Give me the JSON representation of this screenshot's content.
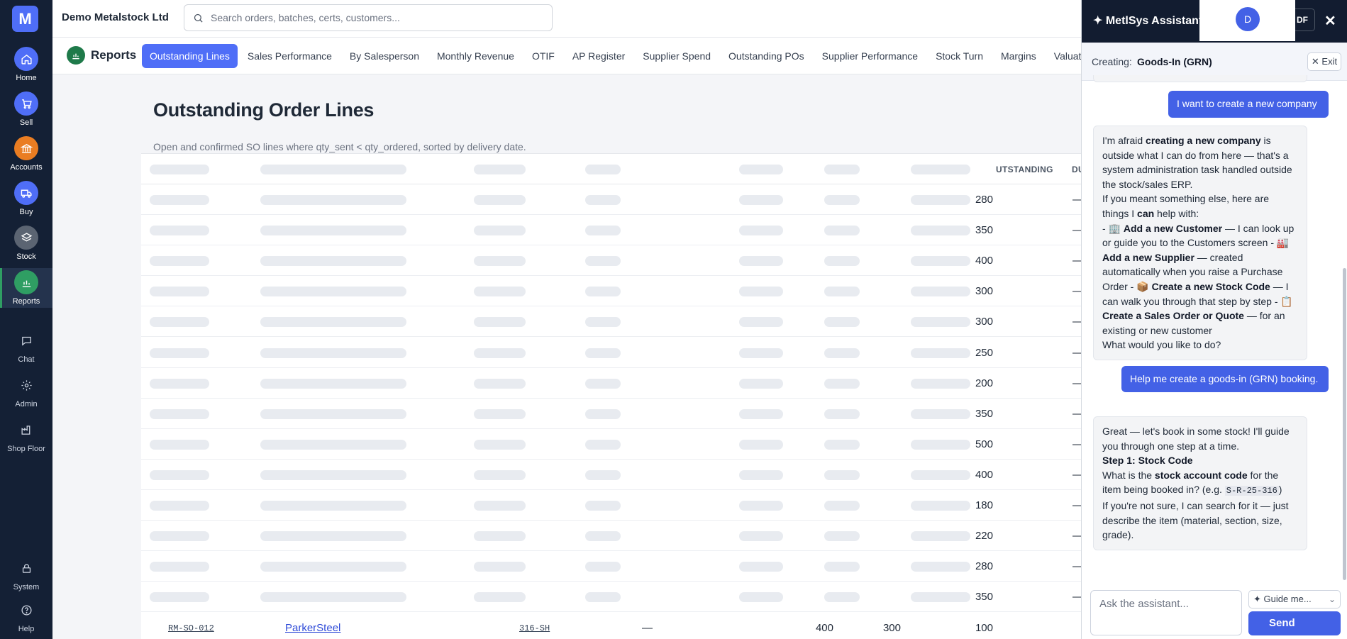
{
  "app": {
    "logo_letter": "M",
    "company": "Demo Metalstock Ltd"
  },
  "search": {
    "placeholder": "Search orders, batches, certs, customers..."
  },
  "nav": [
    {
      "label": "Home",
      "icon": "home-icon",
      "color": "#4f6ef7"
    },
    {
      "label": "Sell",
      "icon": "cart-icon",
      "color": "#4f6ef7"
    },
    {
      "label": "Accounts",
      "icon": "bank-icon",
      "color": "#ea7d22"
    },
    {
      "label": "Buy",
      "icon": "truck-icon",
      "color": "#4f6ef7"
    },
    {
      "label": "Stock",
      "icon": "layers-icon",
      "color": "#5b6472"
    },
    {
      "label": "Reports",
      "icon": "chart-icon",
      "color": "#2f9e63",
      "active": true
    },
    {
      "label": "Chat",
      "icon": "chat-icon"
    },
    {
      "label": "Admin",
      "icon": "gear-icon"
    },
    {
      "label": "Shop Floor",
      "icon": "factory-icon"
    },
    {
      "label": "System",
      "icon": "lock-icon"
    },
    {
      "label": "Help",
      "icon": "help-icon"
    }
  ],
  "reports": {
    "title": "Reports",
    "tabs": [
      "Outstanding Lines",
      "Sales Performance",
      "By Salesperson",
      "Monthly Revenue",
      "OTIF",
      "AP Register",
      "Supplier Spend",
      "Outstanding POs",
      "Supplier Performance",
      "Stock Turn",
      "Margins",
      "Valuat"
    ],
    "active_tab": "Outstanding Lines"
  },
  "page": {
    "title": "Outstanding Order Lines",
    "subtitle": "Open and confirmed SO lines where qty_sent < qty_ordered, sorted by delivery date."
  },
  "table": {
    "headers": {
      "outstanding": "UTSTANDING",
      "due": "DU"
    },
    "loading_outstanding": [
      "280",
      "350",
      "400",
      "300",
      "300",
      "250",
      "200",
      "350",
      "500",
      "400",
      "180",
      "220",
      "280",
      "350"
    ],
    "dash": "—",
    "last_row": {
      "ref": "RM-SO-012",
      "customer": "ParkerSteel",
      "grade": "316-SH",
      "col4": "—",
      "ordered": "400",
      "sent": "300",
      "outstanding": "100"
    }
  },
  "assistant": {
    "title": "✦ MetlSys Assistant",
    "avatar_letter": "D",
    "header_btn": "DF",
    "close": "✕",
    "creating_label": "Creating:",
    "creating_value": "Goods-In (GRN)",
    "exit_label": "✕ Exit",
    "messages": {
      "user1": "I want to create a new company",
      "bot1": {
        "t1": "I'm afraid ",
        "b1": "creating a new company",
        "t2": " is outside what I can do from here — that's a system administration task handled outside the stock/sales ERP.",
        "t3": "If you meant something else, here are things I ",
        "b2": "can",
        "t4": " help with:",
        "t5": "- 🏢 ",
        "b3": "Add a new Customer",
        "t6": " — I can look up or guide you to the Customers screen - 🏭 ",
        "b4": "Add a new Supplier",
        "t7": " — created automatically when you raise a Purchase Order - 📦 ",
        "b5": "Create a new Stock Code",
        "t8": " — I can walk you through that step by step - 📋 ",
        "b6": "Create a Sales Order or Quote",
        "t9": " — for an existing or new customer",
        "t10": "What would you like to do?"
      },
      "user2": "Help me create a goods-in (GRN) booking.",
      "bot2": {
        "t1": "Great — let's book in some stock! I'll guide you through one step at a time.",
        "b1": "Step 1: Stock Code",
        "t2": "What is the ",
        "b2": "stock account code",
        "t3": " for the item being booked in? (e.g. ",
        "code": "S-R-25-316",
        "t4": ")",
        "t5": "If you're not sure, I can search for it — just describe the item (material, section, size, grade)."
      }
    },
    "input_placeholder": "Ask the assistant...",
    "guide_label": "✦ Guide me...",
    "send_label": "Send"
  }
}
